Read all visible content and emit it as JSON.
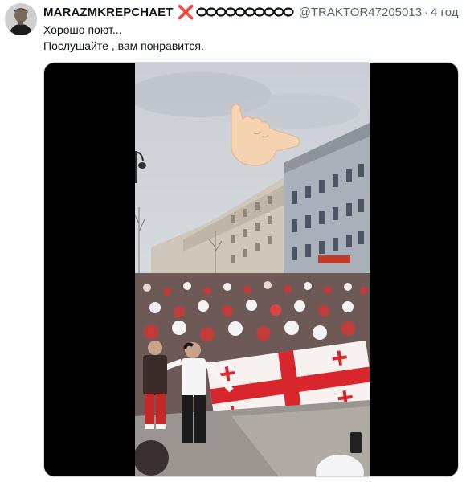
{
  "tweet": {
    "display_name": "MARAZMKREPCHAET",
    "x_mark": "❌",
    "handle": "@TRAKTOR47205013",
    "separator": "·",
    "time": "4 год",
    "text_lines": [
      "Хорошо поют...",
      "Послушайте , вам понравится."
    ]
  },
  "colors": {
    "accent_red": "#d21e2e",
    "secondary_text": "#536471"
  },
  "icons": {
    "x_mark": "cross-mark-icon",
    "chain": "chain-link-icon",
    "hand_emoji": "call-me-hand-icon"
  }
}
